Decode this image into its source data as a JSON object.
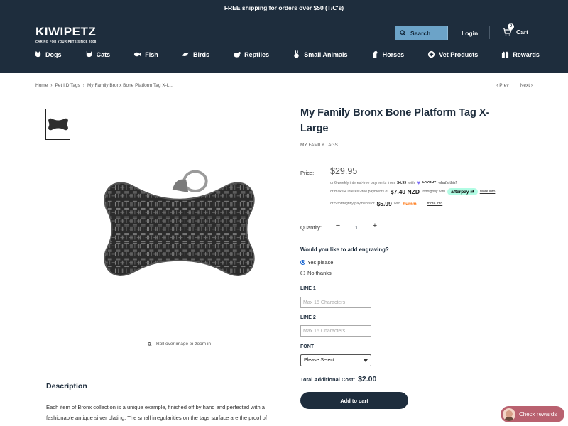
{
  "topbar": {
    "text": "FREE shipping for orders over $50 (T/C's)"
  },
  "header": {
    "logo": "KIWIPETZ",
    "tagline": "CARING FOR YOUR PETS SINCE 2008",
    "search_label": "Search",
    "login_label": "Login",
    "cart_label": "Cart",
    "cart_count": "0"
  },
  "nav": [
    {
      "label": "Dogs",
      "icon": "dog-icon"
    },
    {
      "label": "Cats",
      "icon": "cat-icon"
    },
    {
      "label": "Fish",
      "icon": "fish-icon"
    },
    {
      "label": "Birds",
      "icon": "bird-icon"
    },
    {
      "label": "Reptiles",
      "icon": "reptile-icon"
    },
    {
      "label": "Small Animals",
      "icon": "rabbit-icon"
    },
    {
      "label": "Horses",
      "icon": "horse-icon"
    },
    {
      "label": "Vet Products",
      "icon": "vet-icon"
    },
    {
      "label": "Rewards",
      "icon": "gift-icon"
    }
  ],
  "breadcrumb": {
    "items": [
      "Home",
      "Pet I.D Tags",
      "My Family Bronx Bone Platform Tag X-L..."
    ],
    "separator": "›"
  },
  "pager": {
    "prev": "Prev",
    "next": "Next"
  },
  "gallery": {
    "zoom_hint": "Roll over image to zoom in"
  },
  "product": {
    "title": "My Family Bronx Bone Platform Tag X-Large",
    "vendor": "MY FAMILY TAGS",
    "price_label": "Price:",
    "price": "$29.95",
    "laybuy": {
      "prefix": "or 6 weekly interest-free payments from",
      "amount": "$4.99",
      "with": "with",
      "brand": "LAYBUY",
      "link": "what's this?"
    },
    "afterpay": {
      "prefix": "or make 4 interest-free payments of",
      "amount": "$7.49 NZD",
      "suffix": "fortnightly with",
      "brand": "afterpay",
      "link": "More info"
    },
    "humm": {
      "prefix": "or 5 fortnightly payments of",
      "amount": "$5.99",
      "with": "with",
      "brand": "humm",
      "link": "more info"
    },
    "quantity_label": "Quantity:",
    "quantity": "1",
    "engraving_question": "Would you like to add engraving?",
    "engraving_options": [
      "Yes please!",
      "No thanks"
    ],
    "line1_label": "LINE 1",
    "line1_placeholder": "Max 15 Characters",
    "line2_label": "LINE 2",
    "line2_placeholder": "Max 15 Characters",
    "font_label": "FONT",
    "font_selected": "Please Select",
    "total_label": "Total Additional Cost:",
    "total_amount": "$2.00",
    "add_to_cart": "Add to cart"
  },
  "description": {
    "title": "Description",
    "body": "Each item of Bronx collection is a unique example, finished off by hand and perfected with a fashionable antique silver plating. The small irregularities on the tags surface are the proof of the handcrafted process which makes them authentic"
  },
  "rewards_button": "Check rewards",
  "colors": {
    "header_bg": "#1e2d3d",
    "search_bg": "#6ca3c8",
    "afterpay_bg": "#b2fce4",
    "humm_orange": "#ff6c00",
    "rewards_bg": "#b9616f"
  }
}
